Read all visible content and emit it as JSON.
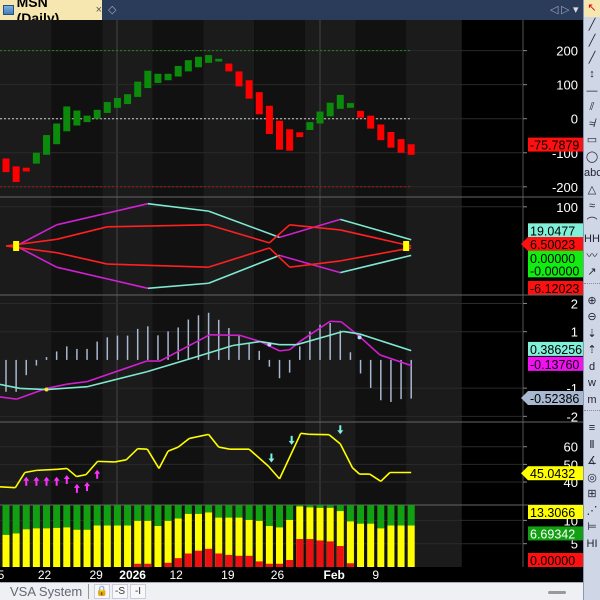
{
  "tab": {
    "title": "MSN (Daily)",
    "close": "×"
  },
  "tabbar_icons": {
    "pin": "◇",
    "prev": "◁",
    "next": "▷",
    "menu": "▾"
  },
  "bottom": {
    "sheet": "VSA System",
    "lock": "🔒",
    "btn_s": "-S",
    "btn_i": "-I"
  },
  "toolbar_icons": [
    "↖",
    "╱",
    "╱",
    "╱",
    "↕",
    "—",
    "⫽",
    "≉",
    "▭",
    "◯",
    "abc",
    "△",
    "≈",
    "⌒",
    "HH",
    "〰",
    "↗",
    "···",
    "⊕",
    "⊖",
    "⇣",
    "⇡",
    "d",
    "w",
    "m",
    "···",
    "≡",
    "Ⅱ",
    "∡",
    "◎",
    "⊞",
    "⋰",
    "⊨",
    "HI"
  ],
  "colors": {
    "up": "#0b8a0b",
    "down": "#ff0000",
    "magenta": "#d020d0",
    "cyan": "#7fe8d0",
    "yellow": "#ffff00",
    "green": "#11a011",
    "hist": "#a8b8d0"
  },
  "chart_data": {
    "type": "multi-panel financial chart",
    "symbol": "MSN (Daily)",
    "x_labels": [
      {
        "i": -0.5,
        "label": "5"
      },
      {
        "i": 3.8,
        "label": "22"
      },
      {
        "i": 8.9,
        "label": "29"
      },
      {
        "i": 12.5,
        "label": "2026"
      },
      {
        "i": 16.8,
        "label": "12"
      },
      {
        "i": 21.9,
        "label": "19"
      },
      {
        "i": 26.8,
        "label": "26"
      },
      {
        "i": 32.4,
        "label": "Feb"
      },
      {
        "i": 36.5,
        "label": "9"
      }
    ],
    "panels": [
      {
        "name": "price",
        "ylim": [
          -230,
          290
        ],
        "ticks": [
          "200",
          "100",
          "0",
          "-100",
          "-200"
        ],
        "tick_values": [
          200,
          100,
          0,
          -100,
          -200
        ],
        "ref_lines": [
          {
            "v": 200,
            "color": "#1a8a1a"
          },
          {
            "v": 0,
            "color": "#cccccc"
          },
          {
            "v": -200,
            "color": "#aa1a1a"
          }
        ],
        "candles": [
          [
            -117,
            -157
          ],
          [
            -140,
            -186
          ],
          [
            -144,
            -155
          ],
          [
            -132,
            -100
          ],
          [
            -106,
            -48
          ],
          [
            -75,
            -14
          ],
          [
            -37,
            36
          ],
          [
            -20,
            24
          ],
          [
            -10,
            9
          ],
          [
            0,
            26
          ],
          [
            17,
            49
          ],
          [
            32,
            61
          ],
          [
            43,
            72
          ],
          [
            64,
            109
          ],
          [
            90,
            141
          ],
          [
            105,
            132
          ],
          [
            113,
            132
          ],
          [
            124,
            155
          ],
          [
            139,
            172
          ],
          [
            151,
            182
          ],
          [
            164,
            187
          ],
          [
            168,
            176
          ],
          [
            162,
            139
          ],
          [
            139,
            95
          ],
          [
            113,
            59
          ],
          [
            78,
            13
          ],
          [
            38,
            -45
          ],
          [
            -6,
            -91
          ],
          [
            -31,
            -94
          ],
          [
            -40,
            -54
          ],
          [
            -33,
            -10
          ],
          [
            -14,
            21
          ],
          [
            7,
            47
          ],
          [
            29,
            70
          ],
          [
            32,
            46
          ],
          [
            23,
            3
          ],
          [
            9,
            -29
          ],
          [
            -17,
            -63
          ],
          [
            -39,
            -85
          ],
          [
            -60,
            -100
          ],
          [
            -75,
            -106
          ]
        ],
        "tags": [
          {
            "text": "-75.7879",
            "v": -76,
            "color": "#ff1010",
            "fg": "#000"
          }
        ]
      },
      {
        "name": "bands",
        "ylim": [
          -125,
          125
        ],
        "ticks": [
          "100"
        ],
        "tick_values": [
          100
        ],
        "lines": [
          {
            "pts": [
              [
                1,
                0
              ],
              [
                5,
                54
              ],
              [
                14,
                108
              ],
              [
                20,
                89
              ],
              [
                27,
                22
              ],
              [
                33,
                68
              ],
              [
                40,
                16
              ]
            ],
            "colors": [
              "#d020d0",
              "#d020d0",
              "#7fe8d0",
              "#7fe8d0",
              "#d020d0",
              "#7fe8d0"
            ]
          },
          {
            "pts": [
              [
                1,
                0
              ],
              [
                5,
                -54
              ],
              [
                14,
                -108
              ],
              [
                20,
                -95
              ],
              [
                27,
                -24
              ],
              [
                33,
                -68
              ],
              [
                40,
                -24
              ]
            ],
            "colors": [
              "#d020d0",
              "#d020d0",
              "#7fe8d0",
              "#7fe8d0",
              "#d020d0",
              "#7fe8d0"
            ]
          },
          {
            "pts": [
              [
                0,
                0
              ],
              [
                5,
                17
              ],
              [
                10,
                49
              ],
              [
                20,
                54
              ],
              [
                26,
                8
              ],
              [
                28,
                54
              ],
              [
                33,
                41
              ],
              [
                40,
                0
              ]
            ],
            "colors": [
              "#ff2020"
            ]
          },
          {
            "pts": [
              [
                0,
                0
              ],
              [
                5,
                -17
              ],
              [
                10,
                -46
              ],
              [
                20,
                -54
              ],
              [
                26,
                -5
              ],
              [
                28,
                -54
              ],
              [
                33,
                -38
              ],
              [
                40,
                -5
              ]
            ],
            "colors": [
              "#ff2020"
            ]
          }
        ],
        "markers": [
          {
            "i": 1,
            "v": 0
          },
          {
            "i": 39.5,
            "v": 0
          }
        ],
        "tags": [
          {
            "text": "19.0477",
            "v": 40,
            "color": "#80f0d8",
            "fg": "#000"
          },
          {
            "text": "6.50023",
            "v": 5,
            "color": "#ff1010",
            "fg": "#000",
            "arrow": true
          },
          {
            "text": "0.00000",
            "v": -30,
            "color": "#10ee10",
            "fg": "#000"
          },
          {
            "text": "-0.00000",
            "v": -62,
            "color": "#10ee10",
            "fg": "#000"
          },
          {
            "text": "-6.12023",
            "v": -110,
            "color": "#ff1010",
            "fg": "#000"
          }
        ]
      },
      {
        "name": "macd",
        "ylim": [
          -2.2,
          2.3
        ],
        "ticks": [
          "2",
          "1",
          "-1",
          "-2"
        ],
        "tick_values": [
          2,
          1,
          -1,
          -2
        ],
        "histogram": [
          -1.13,
          -1.13,
          -0.54,
          -0.2,
          0.1,
          0.3,
          0.48,
          0.39,
          0.39,
          0.65,
          0.8,
          0.86,
          0.86,
          1.1,
          1.19,
          0.87,
          1.01,
          1.15,
          1.43,
          1.58,
          1.67,
          1.42,
          1.13,
          0.87,
          0.6,
          0.32,
          -0.24,
          -0.65,
          -0.45,
          0.48,
          1.01,
          1.25,
          1.31,
          1.04,
          0.27,
          -0.48,
          -0.99,
          -1.43,
          -1.49,
          -1.39,
          -1.37
        ],
        "lines": [
          {
            "pts": [
              [
                -0.6,
                -1.31
              ],
              [
                1.05,
                -1.39
              ],
              [
                4,
                -1.01
              ],
              [
                6,
                -0.86
              ],
              [
                8,
                -0.77
              ],
              [
                13.9,
                -0.04
              ],
              [
                15.2,
                -0.04
              ],
              [
                20.1,
                0.89
              ],
              [
                23.1,
                0.87
              ],
              [
                25.1,
                0.65
              ],
              [
                27,
                0.32
              ],
              [
                28,
                0.36
              ],
              [
                29,
                0.65
              ],
              [
                32,
                1.37
              ],
              [
                33.1,
                1.35
              ],
              [
                34.9,
                0.83
              ],
              [
                36.9,
                0.18
              ],
              [
                40,
                -0.2
              ]
            ],
            "colors": [
              "#d020d0"
            ]
          },
          {
            "pts": [
              [
                -0.6,
                -0.87
              ],
              [
                1.4,
                -1.01
              ],
              [
                4,
                -1.05
              ],
              [
                8,
                -0.95
              ],
              [
                13.9,
                -0.42
              ],
              [
                17.8,
                0
              ],
              [
                22.4,
                0.51
              ],
              [
                25.1,
                0.65
              ],
              [
                27,
                0.54
              ],
              [
                28.7,
                0.54
              ],
              [
                33.3,
                1.01
              ],
              [
                34.9,
                0.92
              ],
              [
                40,
                0.33
              ]
            ],
            "colors": [
              "#7fe8d0"
            ]
          }
        ],
        "dots": [
          {
            "i": 4,
            "v": -1.05,
            "color": "#ffe040"
          },
          {
            "i": 26,
            "v": 0.54,
            "color": "#c0d8ff"
          },
          {
            "i": 34.9,
            "v": 0.8,
            "color": "#c0d8ff"
          }
        ],
        "tags": [
          {
            "text": "0.386256",
            "v": 0.39,
            "color": "#80f0d8",
            "fg": "#000"
          },
          {
            "text": "-0.13760",
            "v": -0.14,
            "color": "#f010f0",
            "fg": "#000"
          },
          {
            "text": "-0.52386",
            "v": -1.35,
            "color": "#a8b8d0",
            "fg": "#000",
            "arrow": true
          }
        ]
      },
      {
        "name": "oscillator",
        "ylim": [
          27,
          74
        ],
        "ticks": [
          "60",
          "50",
          "40"
        ],
        "tick_values": [
          60,
          50,
          40
        ],
        "lines": [
          {
            "pts": [
              [
                -0.6,
                37.3
              ],
              [
                0.92,
                36.8
              ],
              [
                1.86,
                45.4
              ],
              [
                3,
                46.6
              ],
              [
                5.07,
                47.2
              ],
              [
                6.02,
                47.7
              ],
              [
                6.96,
                43.1
              ],
              [
                7.9,
                44.2
              ],
              [
                9.04,
                51.7
              ],
              [
                10.74,
                51.4
              ],
              [
                11.87,
                52.6
              ],
              [
                13,
                58.9
              ],
              [
                13.95,
                58.6
              ],
              [
                15.1,
                47.7
              ],
              [
                16,
                57.5
              ],
              [
                17,
                59.8
              ],
              [
                18.1,
                64.7
              ],
              [
                20,
                67
              ],
              [
                21,
                59.8
              ],
              [
                22.1,
                58.6
              ],
              [
                24,
                58.6
              ],
              [
                25.9,
                49
              ],
              [
                27,
                41.8
              ],
              [
                29.1,
                67.6
              ],
              [
                30,
                67
              ],
              [
                31.9,
                66.8
              ],
              [
                33,
                61.6
              ],
              [
                34.2,
                48.1
              ],
              [
                34.9,
                44.5
              ],
              [
                35.9,
                44.5
              ],
              [
                37,
                40.4
              ],
              [
                37.9,
                45.4
              ],
              [
                40,
                45.4
              ]
            ],
            "colors": [
              "#ffff00"
            ]
          }
        ],
        "up_arrows": [
          [
            2,
            39
          ],
          [
            3,
            39
          ],
          [
            4,
            39
          ],
          [
            5,
            39
          ],
          [
            6,
            40
          ],
          [
            7,
            35
          ],
          [
            8,
            36
          ],
          [
            9,
            43
          ]
        ],
        "down_arrows": [
          [
            26.2,
            55
          ],
          [
            28.2,
            65
          ],
          [
            33,
            71
          ]
        ],
        "tags": [
          {
            "text": "45.0432",
            "v": 45,
            "color": "#ffff00",
            "fg": "#000",
            "arrow": true
          }
        ]
      },
      {
        "name": "volume-stack",
        "ylim": [
          0,
          13.3
        ],
        "ticks": [
          "10",
          "5"
        ],
        "tick_values": [
          10,
          5
        ],
        "green_top": 13.3,
        "yellow": [
          6.9,
          7.2,
          8.1,
          8.3,
          8.3,
          8.4,
          8.5,
          8.0,
          8.0,
          8.9,
          8.9,
          8.9,
          8.9,
          9.9,
          9.9,
          8.8,
          9.9,
          10.4,
          11.4,
          11.4,
          11.7,
          10.6,
          10.6,
          10.6,
          10.1,
          9.9,
          8.8,
          8.5,
          10.1,
          13.0,
          12.8,
          12.7,
          12.7,
          12.0,
          9.8,
          9.3,
          9.3,
          8.3,
          8.9,
          8.9,
          8.9
        ],
        "red": [
          0,
          0,
          0,
          0,
          0,
          0,
          0,
          0,
          0,
          0,
          0,
          0,
          0,
          0.7,
          0.7,
          0,
          0.9,
          1.9,
          2.9,
          3.5,
          3.9,
          2.9,
          2.6,
          2.4,
          2.4,
          1.2,
          0.7,
          0.7,
          1.5,
          6.0,
          6.0,
          5.7,
          5.5,
          4.5,
          0.8,
          0,
          0,
          0,
          0,
          0,
          0
        ],
        "tags": [
          {
            "text": "13.3066",
            "v": 13.3,
            "color": "#ffff00",
            "fg": "#000"
          },
          {
            "text": "6.69342",
            "v": 7.2,
            "color": "#11a011",
            "fg": "#fff"
          },
          {
            "text": "0.00000",
            "v": 0.3,
            "color": "#ff1010",
            "fg": "#000"
          }
        ]
      }
    ]
  }
}
